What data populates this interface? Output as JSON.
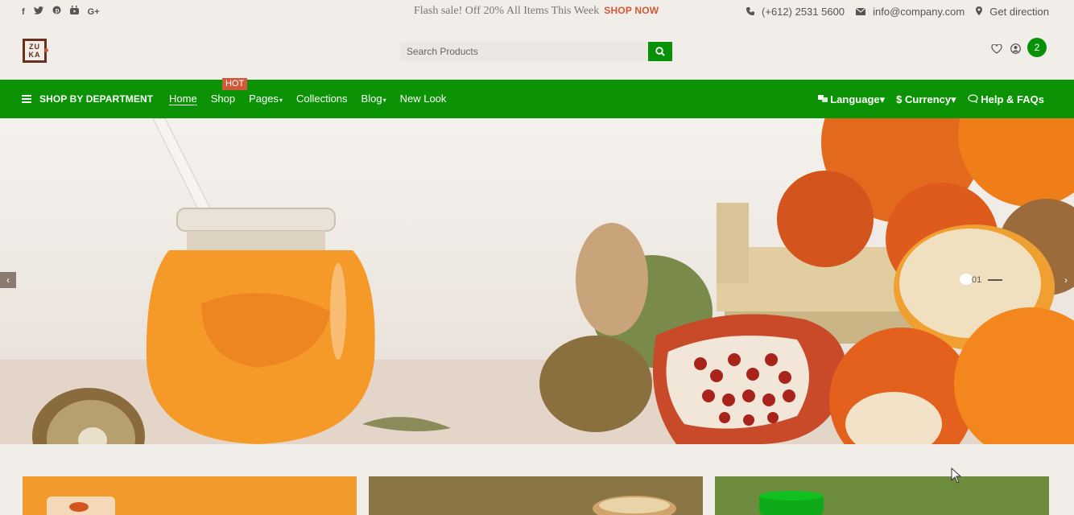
{
  "topbar": {
    "social": [
      {
        "icon": "facebook-icon",
        "glyph": "f"
      },
      {
        "icon": "twitter-icon",
        "glyph": "t"
      },
      {
        "icon": "pinterest-icon",
        "glyph": "p"
      },
      {
        "icon": "youtube-icon",
        "glyph": "▶"
      },
      {
        "icon": "google-plus-icon",
        "glyph": "G+"
      }
    ],
    "flash_text": "Flash sale! Off 20% All Items This Week",
    "flash_link": "SHOP NOW",
    "phone": "(+612) 2531 5600",
    "email": "info@company.com",
    "direction": "Get direction"
  },
  "header": {
    "logo_line1": "ZU",
    "logo_line2": "KA",
    "search_placeholder": "Search Products",
    "cart_count": "2"
  },
  "nav": {
    "department": "SHOP BY DEPARTMENT",
    "items": [
      "Home",
      "Shop",
      "Pages",
      "Collections",
      "Blog",
      "New Look"
    ],
    "hot_badge": "HOT",
    "language": "Language",
    "currency": "Currency",
    "help": "Help & FAQs"
  },
  "hero": {
    "slide_number": "01"
  },
  "colors": {
    "brand_green": "#0b9305",
    "accent": "#d2583b",
    "card1": "#f39a2c",
    "card2": "#8a7645",
    "card3": "#6e8c3e"
  }
}
